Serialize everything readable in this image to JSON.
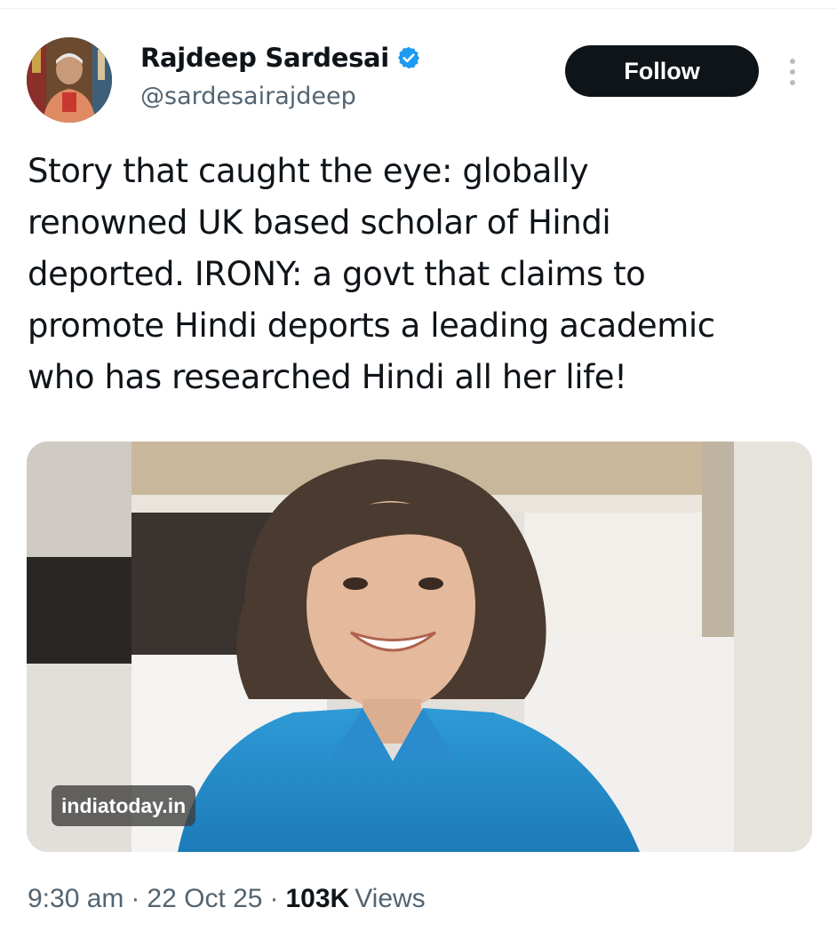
{
  "author": {
    "display_name": "Rajdeep Sardesai",
    "handle": "@sardesairajdeep",
    "verified_icon": "verified-badge-icon",
    "avatar_icon": "profile-photo"
  },
  "actions": {
    "follow_label": "Follow",
    "more_icon": "more-vertical-icon"
  },
  "tweet": {
    "text_lines": [
      "Story that caught the eye: globally",
      "renowned UK based scholar of Hindi",
      "deported. IRONY: a govt that claims to",
      "promote Hindi deports a leading academic",
      "who has researched Hindi all her life!"
    ]
  },
  "media": {
    "source": "indiatoday.in"
  },
  "meta": {
    "time": "9:30 am",
    "separator": "·",
    "date": "22 Oct 25",
    "views_count": "103K",
    "views_label": "Views"
  },
  "colors": {
    "follow_bg": "#0f1419",
    "verified_blue": "#1d9bf0",
    "secondary_text": "#536471"
  }
}
